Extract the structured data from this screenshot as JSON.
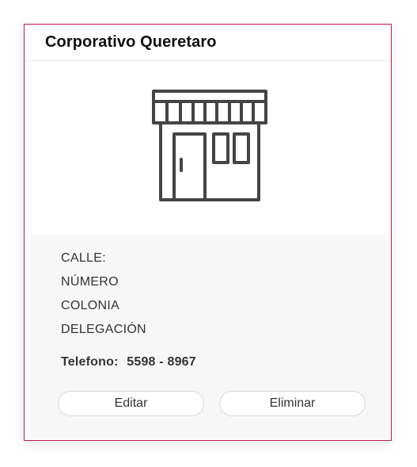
{
  "card": {
    "title": "Corporativo Queretaro",
    "image_icon": "store-front-icon",
    "address": {
      "calle_label": "CALLE:",
      "numero_label": "NÚMERO",
      "colonia_label": "COLONIA",
      "delegacion_label": "DELEGACIÓN"
    },
    "phone": {
      "label": "Telefono:",
      "value": "5598 - 8967"
    },
    "actions": {
      "edit_label": "Editar",
      "delete_label": "Eliminar"
    }
  },
  "colors": {
    "card_border": "#c2185b",
    "info_background": "#f7f7f7",
    "icon_stroke": "#444444"
  }
}
